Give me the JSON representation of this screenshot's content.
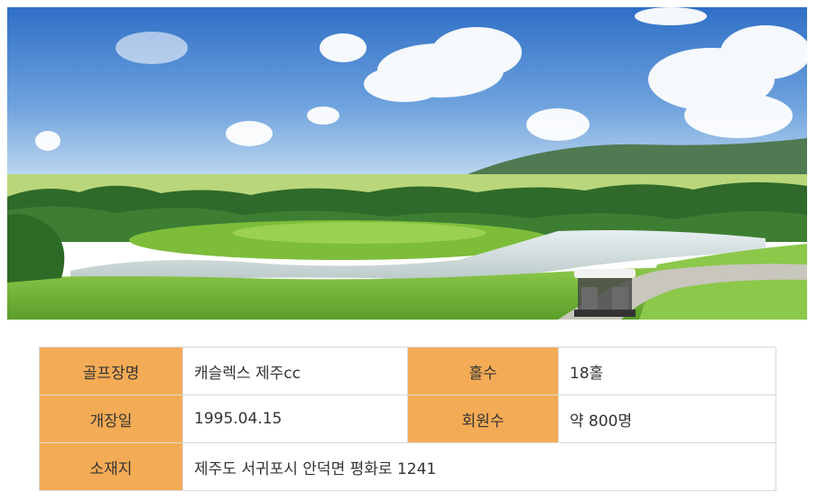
{
  "banner": {
    "image": "golf-course-landscape"
  },
  "info_table": {
    "rows": [
      {
        "label1": "골프장명",
        "value1": "캐슬렉스 제주cc",
        "label2": "홀수",
        "value2": "18홀"
      },
      {
        "label1": "개장일",
        "value1": "1995.04.15",
        "label2": "회원수",
        "value2": "약 800명"
      },
      {
        "label1": "소재지",
        "value1": "제주도 서귀포시 안덕면 평화로 1241"
      }
    ]
  },
  "colors": {
    "label_bg": "#f4ab55",
    "border": "#d9d9d9",
    "text": "#333333"
  }
}
